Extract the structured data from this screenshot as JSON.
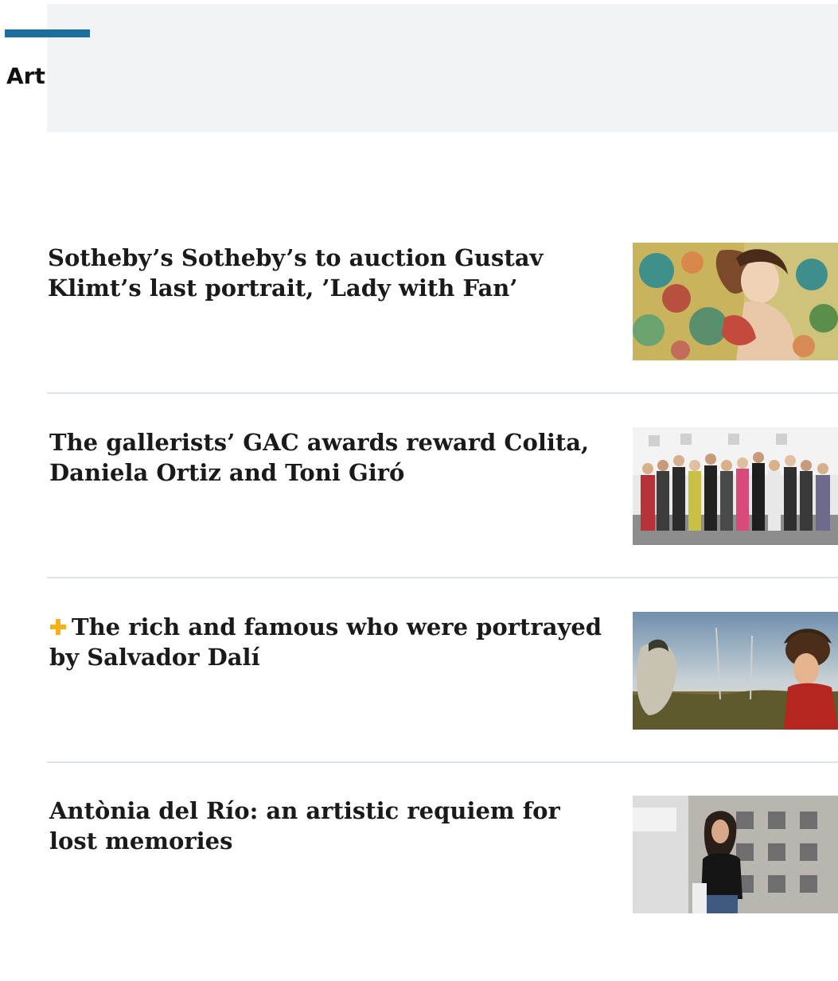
{
  "section": {
    "label": "Art",
    "accent_color": "#1c6e9e"
  },
  "articles": [
    {
      "headline": "Sotheby’s Sotheby’s to auction Gustav Klimt’s last portrait, ’Lady with Fan’",
      "premium": false,
      "image": "klimt-lady-with-fan-painting"
    },
    {
      "headline": "The gallerists’ GAC awards reward Colita, Daniela Ortiz and Toni Giró",
      "premium": false,
      "image": "gac-awards-group-photo"
    },
    {
      "headline": "The rich and famous who were portrayed by Salvador Dalí",
      "premium": true,
      "premium_icon": "plus-icon",
      "premium_color": "#f3b21c",
      "image": "dali-portrait-painting"
    },
    {
      "headline": "Antònia del Río: an artistic requiem for lost memories",
      "premium": false,
      "image": "artist-in-gallery-photo"
    }
  ]
}
